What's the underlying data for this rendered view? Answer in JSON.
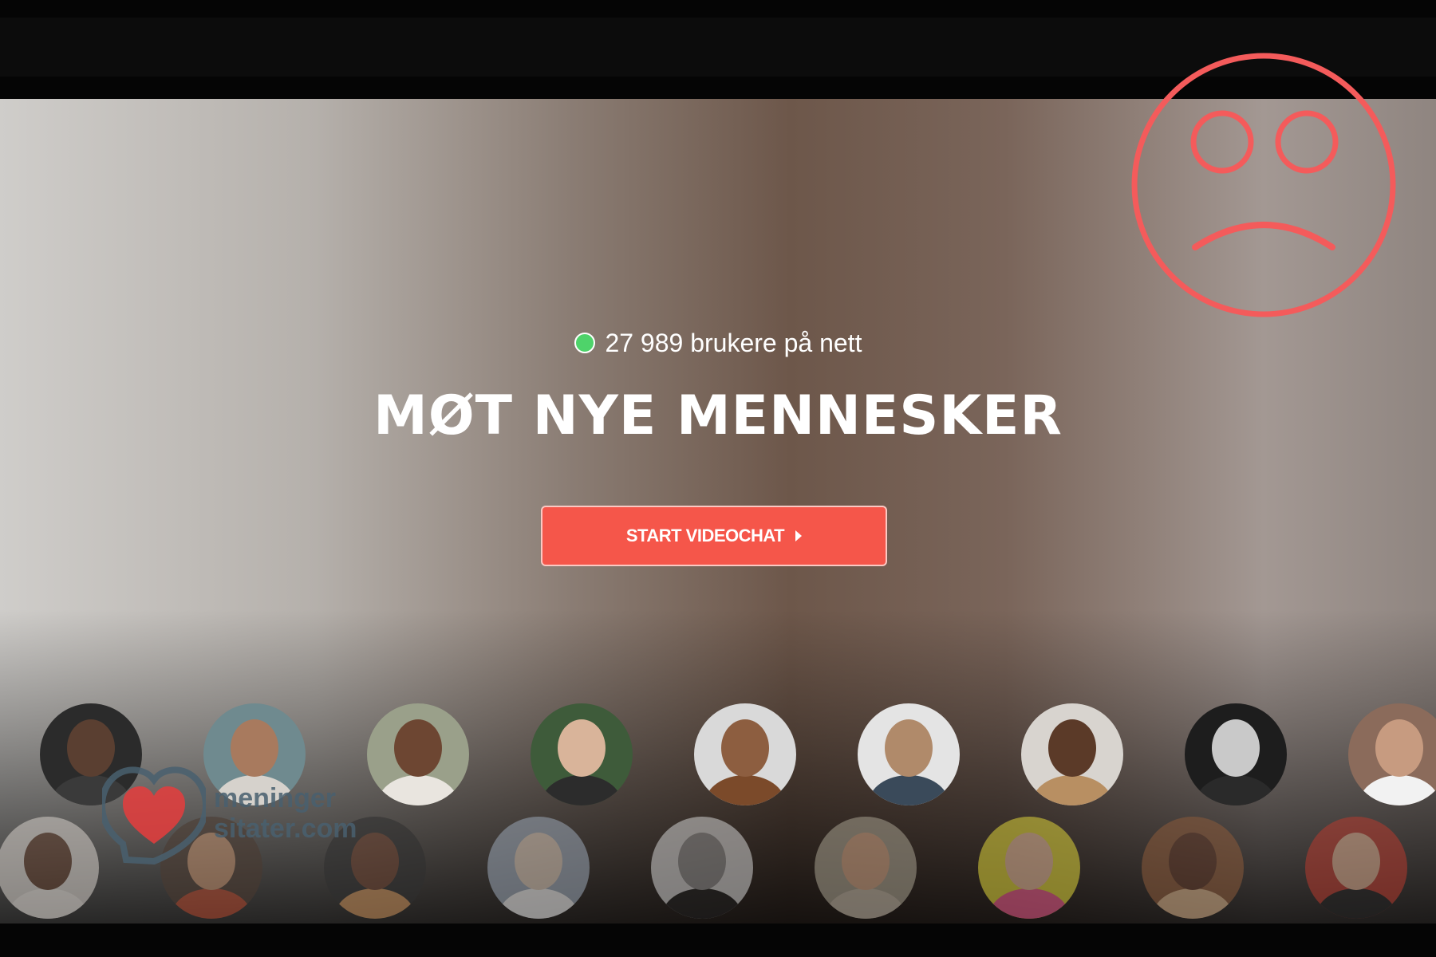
{
  "hero": {
    "online_count_text": "27 989 brukere på nett",
    "headline": "MØT NYE MENNESKER",
    "cta_label": "START VIDEOCHAT",
    "cta_icon": "play-triangle-icon"
  },
  "overlay": {
    "icon": "sad-face-icon"
  },
  "watermark": {
    "line1": "meninger",
    "line2": "sitater.com",
    "icon": "heart-speech-bubble-icon"
  },
  "colors": {
    "accent": "#f5564a",
    "online_dot": "#4ed36a",
    "sad_face": "#f45b5b"
  },
  "avatars_row1": [
    {
      "skin": "#5a3f31",
      "shirt": "#3a3a3a",
      "bg": "#2b2b2b"
    },
    {
      "skin": "#a87a5e",
      "shirt": "#d6d2cc",
      "bg": "#6f8a8f"
    },
    {
      "skin": "#6d4632",
      "shirt": "#e9e5df",
      "bg": "#9aa08a"
    },
    {
      "skin": "#d9b49a",
      "shirt": "#2c2c2c",
      "bg": "#3e5b3a"
    },
    {
      "skin": "#8d5e40",
      "shirt": "#7b4a2a",
      "bg": "#d9d9d9"
    },
    {
      "skin": "#b08a6a",
      "shirt": "#3a4a5a",
      "bg": "#e4e4e4"
    },
    {
      "skin": "#5b3a28",
      "shirt": "#b88f62",
      "bg": "#d8d4cf"
    },
    {
      "skin": "#c9c9c9",
      "shirt": "#2a2a2a",
      "bg": "#1d1d1d"
    },
    {
      "skin": "#c79b80",
      "shirt": "#f2f2f2",
      "bg": "#8b6b5b"
    }
  ],
  "avatars_row2": [
    {
      "skin": "#5d3b2a",
      "shirt": "#e8e2dc",
      "bg": "#d5cfc9"
    },
    {
      "skin": "#c08e6b",
      "shirt": "#b3472d",
      "bg": "#4b3a30"
    },
    {
      "skin": "#6c4230",
      "shirt": "#c9905a",
      "bg": "#2f2f2f"
    },
    {
      "skin": "#d9c8b8",
      "shirt": "#eeeeee",
      "bg": "#9aa6b5"
    },
    {
      "skin": "#8a8a8a",
      "shirt": "#1f1f1f",
      "bg": "#cfcfcf"
    },
    {
      "skin": "#d2a687",
      "shirt": "#c2b8a8",
      "bg": "#a59f8e"
    },
    {
      "skin": "#e2b899",
      "shirt": "#e75a8a",
      "bg": "#dcd23a"
    },
    {
      "skin": "#5e3828",
      "shirt": "#d8b28a",
      "bg": "#8b5a3a"
    },
    {
      "skin": "#d7a98c",
      "shirt": "#222222",
      "bg": "#b53a2e"
    }
  ]
}
